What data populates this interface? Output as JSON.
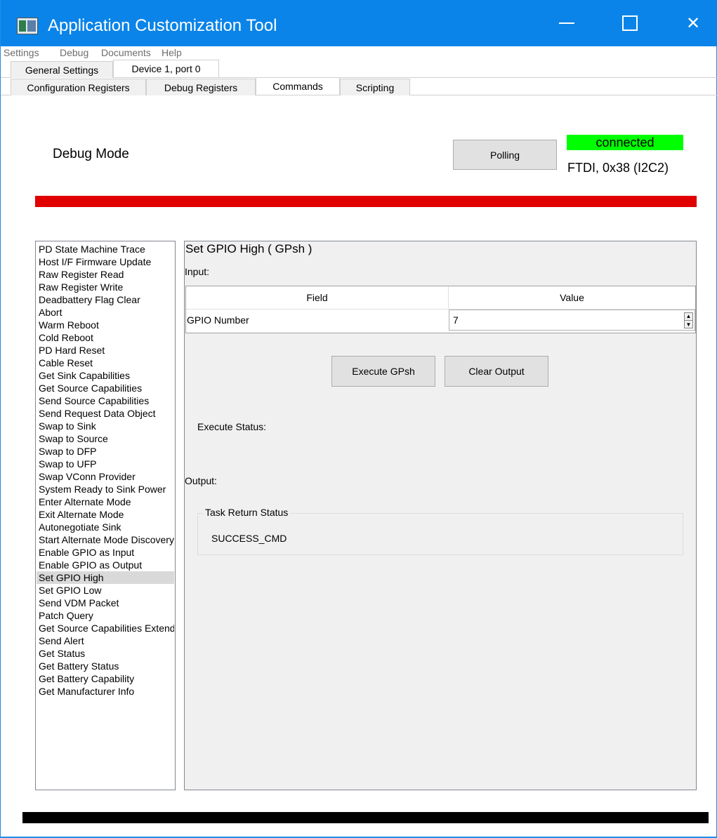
{
  "window": {
    "title": "Application Customization Tool",
    "accent_color": "#0a84e8"
  },
  "menu": [
    {
      "label": "Settings",
      "key": "S"
    },
    {
      "label": "Debug",
      "key": "D"
    },
    {
      "label": "Documents",
      "key": "D"
    },
    {
      "label": "Help",
      "key": "H"
    }
  ],
  "tabs_top": [
    {
      "label": "General Settings",
      "active": false
    },
    {
      "label": "Device 1, port 0",
      "active": true
    }
  ],
  "tabs_sub": [
    {
      "label": "Configuration Registers",
      "active": false
    },
    {
      "label": "Debug Registers",
      "active": false
    },
    {
      "label": "Commands",
      "active": true
    },
    {
      "label": "Scripting",
      "active": false
    }
  ],
  "header": {
    "mode_label": "Debug Mode",
    "polling_label": "Polling",
    "connection_status": "connected",
    "connection_status_color": "#00ff00",
    "connection_info": "FTDI, 0x38 (I2C2)",
    "mode_bar_color": "#e10000"
  },
  "commands": [
    "PD State Machine Trace",
    "Host I/F Firmware Update",
    "Raw Register Read",
    "Raw Register Write",
    "Deadbattery Flag Clear",
    "Abort",
    "Warm Reboot",
    "Cold Reboot",
    "PD Hard Reset",
    "Cable Reset",
    "Get Sink Capabilities",
    "Get Source Capabilities",
    "Send Source Capabilities",
    "Send Request Data Object",
    "Swap to Sink",
    "Swap to Source",
    "Swap to DFP",
    "Swap to UFP",
    "Swap VConn Provider",
    "System Ready to Sink Power",
    "Enter Alternate Mode",
    "Exit Alternate Mode",
    "Autonegotiate Sink",
    "Start Alternate Mode Discovery",
    "Enable GPIO as Input",
    "Enable GPIO as Output",
    "Set GPIO High",
    "Set GPIO Low",
    "Send VDM Packet",
    "Patch Query",
    "Get Source Capabilities Extended",
    "Send Alert",
    "Get Status",
    "Get Battery Status",
    "Get Battery Capability",
    "Get Manufacturer Info"
  ],
  "selected_command": "Set GPIO High",
  "panel": {
    "title": "Set GPIO High  ( GPsh )",
    "input_label": "Input:",
    "table_headers": {
      "field": "Field",
      "value": "Value"
    },
    "rows": [
      {
        "field": "GPIO Number",
        "value": "7"
      }
    ],
    "execute_label": "Execute GPsh",
    "clear_label": "Clear Output",
    "execute_status_label": "Execute Status:",
    "output_label": "Output:",
    "task_group_title": "Task Return Status",
    "task_return_value": "SUCCESS_CMD"
  }
}
